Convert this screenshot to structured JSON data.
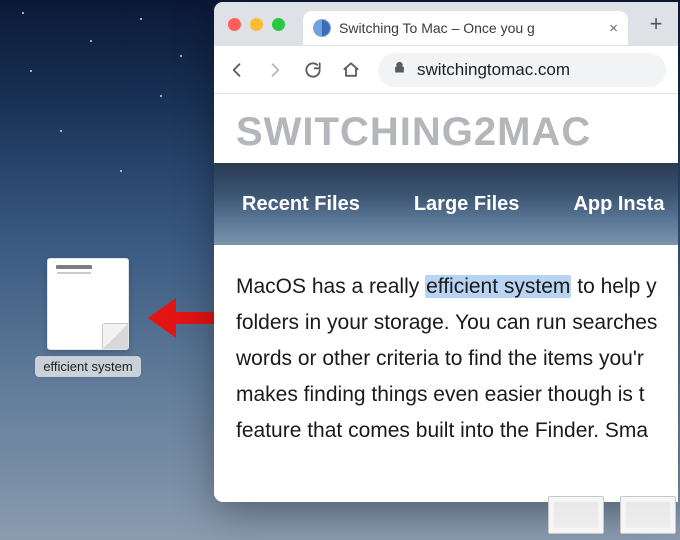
{
  "desktop": {
    "file_label": "efficient system"
  },
  "browser": {
    "tab_title": "Switching To Mac – Once you g",
    "url": "switchingtomac.com"
  },
  "site": {
    "logo": "SWITCHING2MAC",
    "nav": [
      "Recent Files",
      "Large Files",
      "App Insta"
    ]
  },
  "article": {
    "pre_highlight": "MacOS has a really ",
    "highlight": "efficient system",
    "post_highlight": " to help y",
    "line2": "folders in your storage. You can run searches",
    "line3": "words or other criteria to find the items you'r",
    "line4": "makes finding things even easier though is t",
    "line5": "feature that comes built into the Finder. Sma"
  }
}
